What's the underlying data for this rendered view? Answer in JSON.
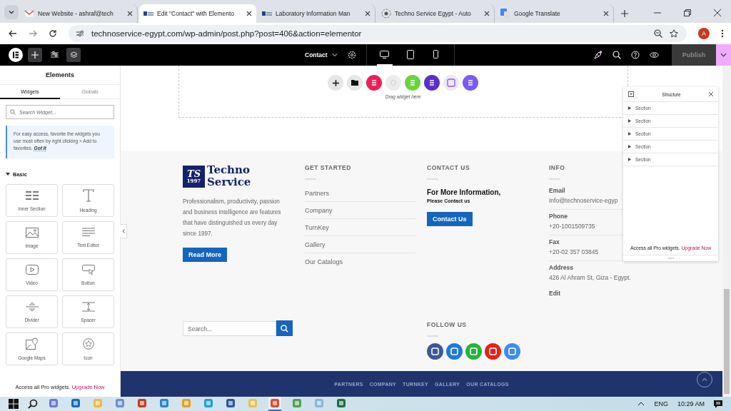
{
  "browser": {
    "tabs": [
      {
        "kind": "mail",
        "title": "New Website - ashraf@tech",
        "selected": false
      },
      {
        "kind": "site",
        "title": "Edit \"Contact\" with Elemento",
        "selected": true
      },
      {
        "kind": "site",
        "title": "Laboratory Information Man",
        "selected": false
      },
      {
        "kind": "ring",
        "title": "Techno Service Egypt - Auto",
        "selected": false
      },
      {
        "kind": "translate",
        "title": "Google Translate",
        "selected": false
      }
    ],
    "url": "technoservice-egypt.com/wp-admin/post.php?post=406&action=elementor",
    "profile": "A"
  },
  "editor_bar": {
    "page_name": "Contact",
    "devices": [
      {
        "selected": true
      },
      {
        "selected": false
      },
      {
        "selected": false
      }
    ],
    "publish": "Publish"
  },
  "panel": {
    "title": "Elements",
    "tabs": [
      {
        "label": "Widgets",
        "selected": true
      },
      {
        "label": "Globals",
        "selected": false
      }
    ],
    "search": {
      "placeholder": "Search Widget..."
    },
    "tip": "For easy access, favorite the widgets you use most often by right clicking > Add to favorites.",
    "tip_link": "Got It",
    "category": "Basic",
    "widgets": [
      {
        "kind": "inner-section",
        "label": "Inner Section"
      },
      {
        "kind": "heading",
        "label": "Heading"
      },
      {
        "kind": "image",
        "label": "Image"
      },
      {
        "kind": "text-editor",
        "label": "Text Editor"
      },
      {
        "kind": "video",
        "label": "Video"
      },
      {
        "kind": "button",
        "label": "Button"
      },
      {
        "kind": "divider",
        "label": "Divider"
      },
      {
        "kind": "spacer",
        "label": "Spacer"
      },
      {
        "kind": "map",
        "label": "Google Maps"
      },
      {
        "kind": "icon",
        "label": "Icon"
      }
    ],
    "promo": "Access all Pro widgets.",
    "promo_link": "Upgrade Now"
  },
  "canvas": {
    "drop_hint": "Drag widget here"
  },
  "footer": {
    "logo": {
      "mark": "TS",
      "year": "1997",
      "line1": "Techno",
      "line2": "Service"
    },
    "about": "Professionalism, productivity, passion and business intelligence are features that have distinguished us every day since 1997.",
    "read_more": "Read More",
    "get_started": {
      "heading": "GET STARTED",
      "links": [
        "Partners",
        "Company",
        "TurnKey",
        "Gallery",
        "Our Catalogs"
      ]
    },
    "contact": {
      "heading": "CONTACT US",
      "title": "For More Information,",
      "subtitle": "Please Contact us",
      "button": "Contact Us"
    },
    "info": {
      "heading": "INFO",
      "items": [
        {
          "label": "Email",
          "value": "Info@technoservice-egyp"
        },
        {
          "label": "Phone",
          "value": "+20-1001509735"
        },
        {
          "label": "Fax",
          "value": "+20-02 357 03845"
        },
        {
          "label": "Address",
          "value": "426 Al Ahram St, Giza - Egypt."
        }
      ],
      "edit": "Edit"
    },
    "search": {
      "placeholder": "Search..."
    },
    "follow": {
      "heading": "FOLLOW US"
    },
    "bottom_links": [
      "PARTNERS",
      "COMPANY",
      "TURNKEY",
      "GALLERY",
      "OUR CATALOGS"
    ]
  },
  "structure": {
    "title": "Structure",
    "sections": [
      "Section",
      "Section",
      "Section",
      "Section",
      "Section"
    ],
    "promo": "Access all Pro widgets.",
    "promo_link": "Upgrade Now"
  },
  "taskbar": {
    "language": "ENG",
    "time": "10:29 AM"
  }
}
